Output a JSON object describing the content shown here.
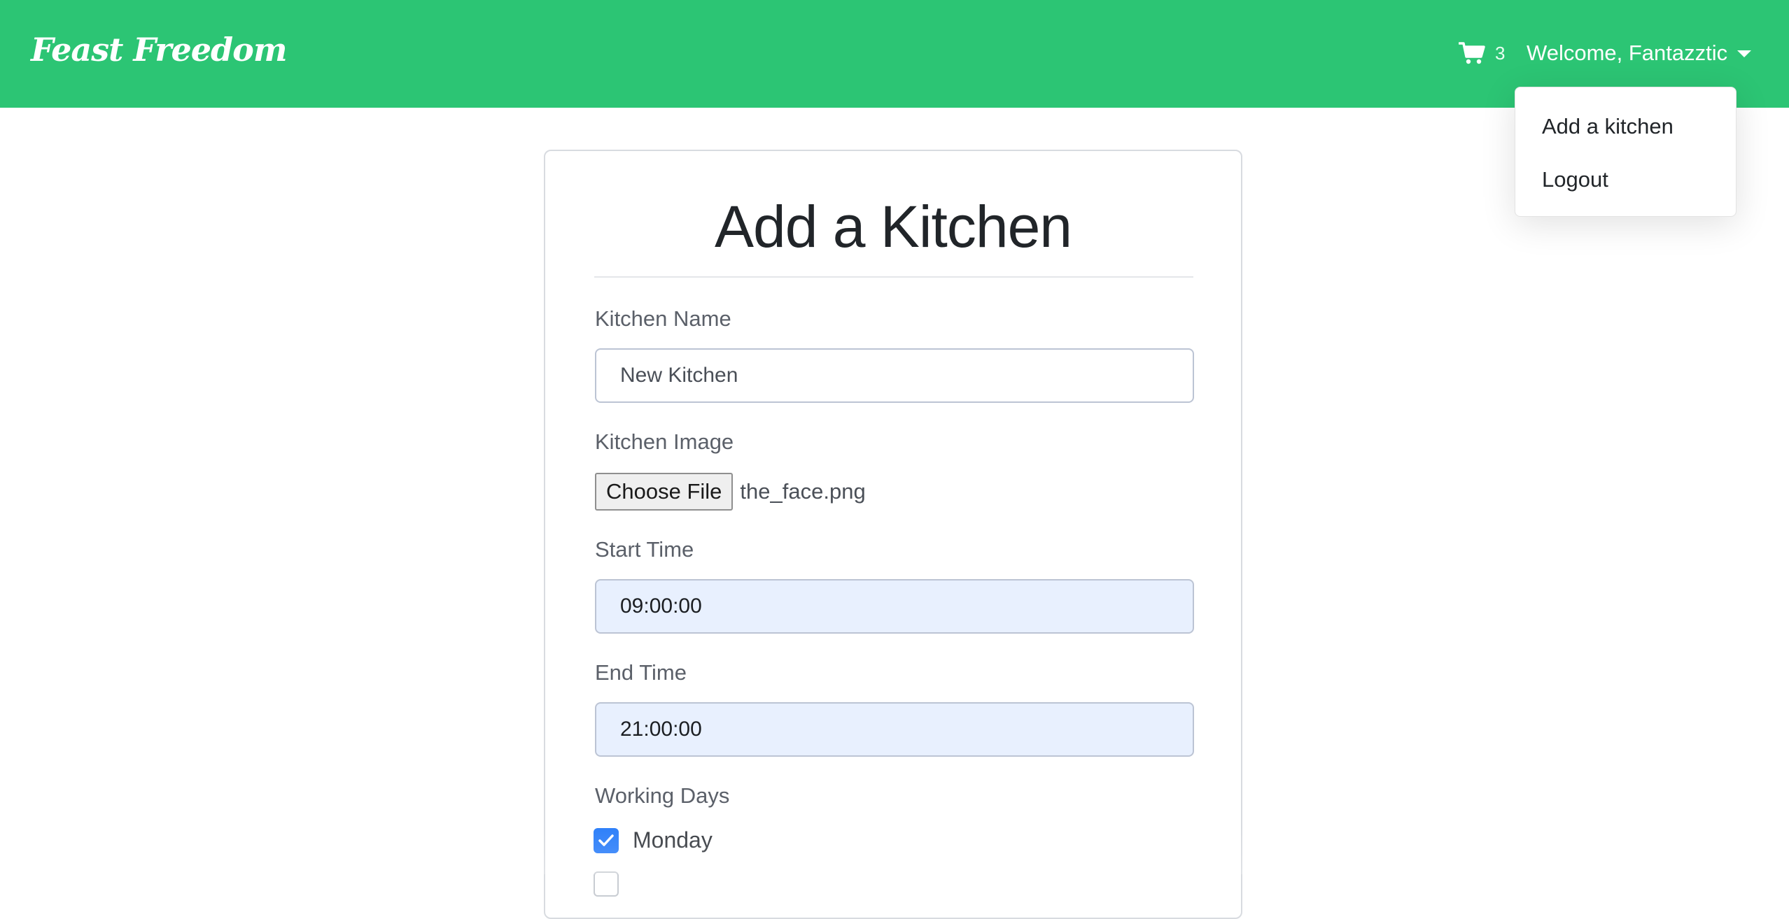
{
  "navbar": {
    "brand": "Feast Freedom",
    "cart_icon": "shopping-cart-icon",
    "cart_count": "3",
    "welcome": "Welcome, Fantazztic"
  },
  "dropdown": {
    "items": [
      {
        "label": "Add a kitchen"
      },
      {
        "label": "Logout"
      }
    ]
  },
  "form": {
    "title": "Add a Kitchen",
    "kitchen_name": {
      "label": "Kitchen Name",
      "value": "New Kitchen"
    },
    "kitchen_image": {
      "label": "Kitchen Image",
      "button": "Choose File",
      "file": "the_face.png"
    },
    "start_time": {
      "label": "Start Time",
      "value": "09:00:00"
    },
    "end_time": {
      "label": "End Time",
      "value": "21:00:00"
    },
    "working_days": {
      "label": "Working Days",
      "days": [
        {
          "label": "Monday",
          "checked": true
        }
      ]
    }
  },
  "colors": {
    "navbar": "#2cc574",
    "checkbox": "#2d7ff9",
    "autofill": "#e8f0fe"
  }
}
